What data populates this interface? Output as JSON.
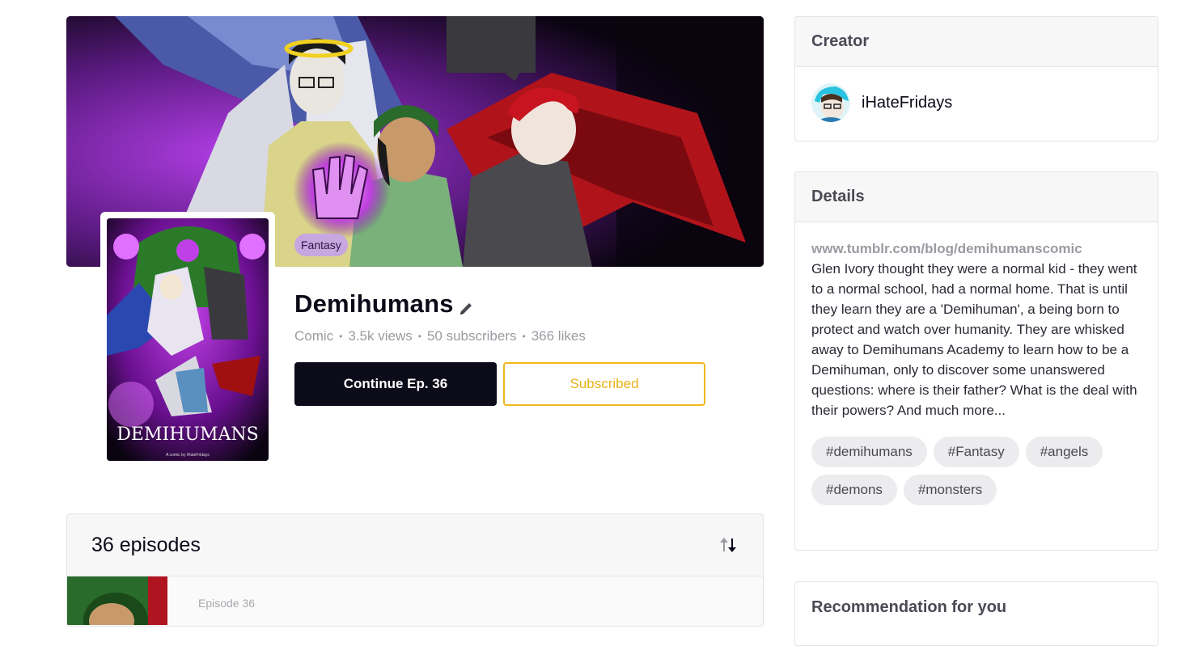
{
  "banner": {
    "genre": "Fantasy"
  },
  "cover": {
    "title": "DEMIHUMANS",
    "subtitle": "A comic by iHateFridays"
  },
  "series": {
    "title": "Demihumans",
    "type": "Comic",
    "views": "3.5k views",
    "subscribers": "50 subscribers",
    "likes": "366 likes",
    "continue_label": "Continue Ep. 36",
    "subscribe_label": "Subscribed"
  },
  "episodes": {
    "count_label": "36 episodes",
    "items": [
      {
        "label": "Episode 36"
      }
    ]
  },
  "sidebar": {
    "creator": {
      "heading": "Creator",
      "name": "iHateFridays"
    },
    "details": {
      "heading": "Details",
      "link": "www.tumblr.com/blog/demihumanscomic",
      "description": "Glen Ivory thought they were a normal kid - they went to a normal school, had a normal home. That is until they learn they are a 'Demihuman', a being born to protect and watch over humanity. They are whisked away to Demihumans Academy to learn how to be a Demihuman, only to discover some unanswered questions: where is their father? What is the deal with their powers? And much more...",
      "tags": [
        "#demihumans",
        "#Fantasy",
        "#angels",
        "#demons",
        "#monsters"
      ]
    },
    "recommendation": {
      "heading": "Recommendation for you"
    }
  },
  "colors": {
    "primary_button": "#0c0b1a",
    "subscribed_accent": "#f0b81e",
    "genre_chip": "#c8a6e0"
  }
}
